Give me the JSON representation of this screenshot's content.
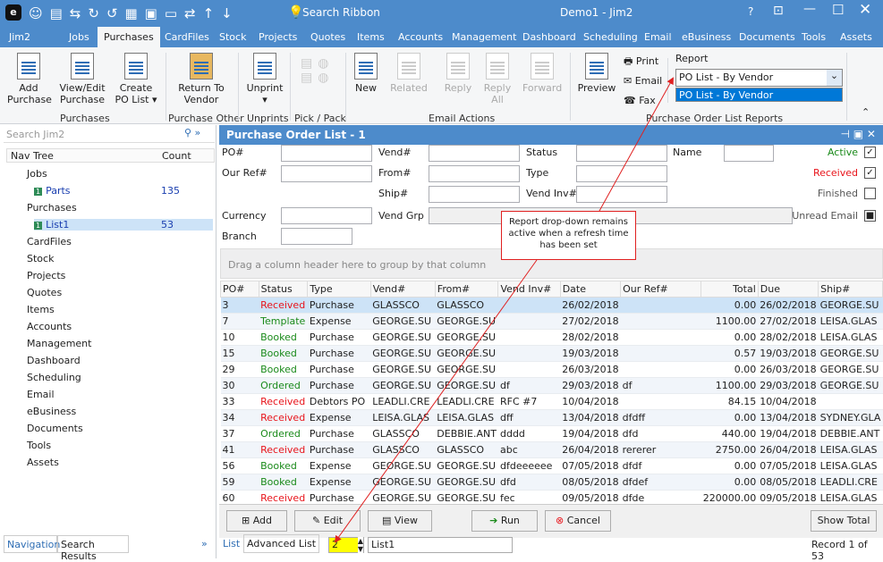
{
  "titlebar": {
    "title": "Demo1 - Jim2",
    "search": "Search Ribbon",
    "help": "?"
  },
  "tabs": [
    "Jim2",
    "Jobs",
    "Purchases",
    "CardFiles",
    "Stock",
    "Projects",
    "Quotes",
    "Items",
    "Accounts",
    "Management",
    "Dashboard",
    "Scheduling",
    "Email",
    "eBusiness",
    "Documents",
    "Tools",
    "Assets"
  ],
  "active_tab": "Purchases",
  "ribbon": {
    "add_purchase": "Add Purchase",
    "view_edit": "View/Edit Purchase",
    "create_po_list": "Create PO List",
    "group_purchases": "Purchases",
    "return_to_vendor": "Return To Vendor",
    "group_purchase_other": "Purchase Other",
    "unprint": "Unprint",
    "group_unprints": "Unprints",
    "group_pick_pack": "Pick / Pack",
    "new": "New",
    "related": "Related",
    "reply": "Reply",
    "reply_all": "Reply All",
    "forward": "Forward",
    "group_email_actions": "Email Actions",
    "preview": "Preview",
    "print": "Print",
    "email": "Email",
    "fax": "Fax",
    "report_label": "Report",
    "report_value": "PO List - By Vendor",
    "report_option": "PO List - By Vendor",
    "group_reports": "Purchase Order List Reports"
  },
  "nav": {
    "search_placeholder": "Search Jim2",
    "col_tree": "Nav Tree",
    "col_count": "Count",
    "items": [
      {
        "label": "Jobs"
      },
      {
        "label": "Parts",
        "count": "135"
      },
      {
        "label": "Purchases"
      },
      {
        "label": "List1",
        "count": "53"
      },
      {
        "label": "CardFiles"
      },
      {
        "label": "Stock"
      },
      {
        "label": "Projects"
      },
      {
        "label": "Quotes"
      },
      {
        "label": "Items"
      },
      {
        "label": "Accounts"
      },
      {
        "label": "Management"
      },
      {
        "label": "Dashboard"
      },
      {
        "label": "Scheduling"
      },
      {
        "label": "Email"
      },
      {
        "label": "eBusiness"
      },
      {
        "label": "Documents"
      },
      {
        "label": "Tools"
      },
      {
        "label": "Assets"
      }
    ],
    "tab_navigation": "Navigation",
    "tab_search_results": "Search Results"
  },
  "main": {
    "title": "Purchase Order List - 1",
    "filters": {
      "po": "PO#",
      "our_ref": "Our Ref#",
      "vend": "Vend#",
      "from": "From#",
      "ship": "Ship#",
      "status": "Status",
      "type": "Type",
      "vend_inv": "Vend Inv#",
      "name": "Name",
      "currency": "Currency",
      "vend_grp": "Vend Grp",
      "branch": "Branch",
      "or": "OR",
      "active": "Active",
      "received": "Received",
      "finished": "Finished",
      "unread_email": "Unread Email"
    },
    "group_hint": "Drag a column header here to group by that column",
    "columns": [
      "PO#",
      "Status",
      "Type",
      "Vend#",
      "From#",
      "Vend Inv#",
      "Date",
      "Our Ref#",
      "Total",
      "Due",
      "Ship#"
    ],
    "rows": [
      [
        "3",
        "Received",
        "Purchase",
        "GLASSCO",
        "GLASSCO",
        "",
        "26/02/2018",
        "",
        "0.00",
        "26/02/2018",
        "GEORGE.SU"
      ],
      [
        "7",
        "Template",
        "Expense",
        "GEORGE.SU",
        "GEORGE.SU",
        "",
        "27/02/2018",
        "",
        "1100.00",
        "27/02/2018",
        "LEISA.GLAS"
      ],
      [
        "10",
        "Booked",
        "Purchase",
        "GEORGE.SU",
        "GEORGE.SU",
        "",
        "28/02/2018",
        "",
        "0.00",
        "28/02/2018",
        "LEISA.GLAS"
      ],
      [
        "15",
        "Booked",
        "Purchase",
        "GEORGE.SU",
        "GEORGE.SU",
        "",
        "19/03/2018",
        "",
        "0.57",
        "19/03/2018",
        "GEORGE.SU"
      ],
      [
        "29",
        "Booked",
        "Purchase",
        "GEORGE.SU",
        "GEORGE.SU",
        "",
        "26/03/2018",
        "",
        "0.00",
        "26/03/2018",
        "GEORGE.SU"
      ],
      [
        "30",
        "Ordered",
        "Purchase",
        "GEORGE.SU",
        "GEORGE.SU",
        "df",
        "29/03/2018",
        "df",
        "1100.00",
        "29/03/2018",
        "GEORGE.SU"
      ],
      [
        "33",
        "Received",
        "Debtors PO",
        "LEADLI.CRE",
        "LEADLI.CRE",
        "RFC #7",
        "10/04/2018",
        "",
        "84.15",
        "10/04/2018",
        ""
      ],
      [
        "34",
        "Received",
        "Expense",
        "LEISA.GLAS",
        "LEISA.GLAS",
        "dff",
        "13/04/2018",
        "dfdff",
        "0.00",
        "13/04/2018",
        "SYDNEY.GLA"
      ],
      [
        "37",
        "Ordered",
        "Purchase",
        "GLASSCO",
        "DEBBIE.ANT",
        "dddd",
        "19/04/2018",
        "dfd",
        "440.00",
        "19/04/2018",
        "DEBBIE.ANT"
      ],
      [
        "41",
        "Received",
        "Purchase",
        "GLASSCO",
        "GLASSCO",
        "abc",
        "26/04/2018",
        "rererer",
        "2750.00",
        "26/04/2018",
        "LEISA.GLAS"
      ],
      [
        "56",
        "Booked",
        "Expense",
        "GEORGE.SU",
        "GEORGE.SU",
        "dfdeeeeee",
        "07/05/2018",
        "dfdf",
        "0.00",
        "07/05/2018",
        "LEISA.GLAS"
      ],
      [
        "59",
        "Booked",
        "Expense",
        "GEORGE.SU",
        "GEORGE.SU",
        "dfd",
        "08/05/2018",
        "dfdef",
        "0.00",
        "08/05/2018",
        "LEADLI.CRE"
      ],
      [
        "60",
        "Received",
        "Purchase",
        "GEORGE.SU",
        "GEORGE.SU",
        "fec",
        "09/05/2018",
        "dfde",
        "220000.00",
        "09/05/2018",
        "LEISA.GLAS"
      ]
    ],
    "buttons": {
      "add": "Add",
      "edit": "Edit",
      "view": "View",
      "run": "Run",
      "cancel": "Cancel",
      "show_total": "Show Total"
    },
    "bottom": {
      "tab_list": "List",
      "tab_advanced": "Advanced List",
      "refresh": "2",
      "list_name": "List1",
      "record": "Record 1 of 53"
    }
  },
  "callout": "Report drop-down remains active when a refresh time has been set",
  "colors": {
    "accent": "#4d8bcb",
    "received": "#e8141b",
    "booked": "#1a8a1a",
    "annotation": "#e02020"
  }
}
